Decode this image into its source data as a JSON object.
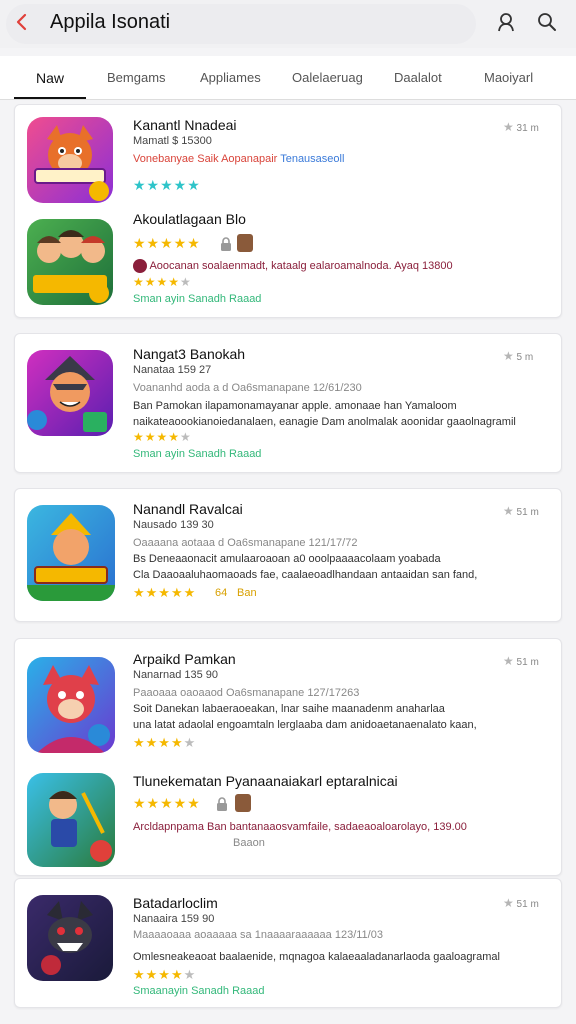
{
  "header": {
    "title": "Appila Isonati",
    "back_icon": "chevron-left-icon",
    "account_icon": "person-icon",
    "search_icon": "search-icon",
    "accent": "#e0403a"
  },
  "tabs": [
    {
      "label": "Naw"
    },
    {
      "label": "Bemgams"
    },
    {
      "label": "Appliames"
    },
    {
      "label": "Oalelaeruag"
    },
    {
      "label": "Daalalot"
    },
    {
      "label": "Maoiyarl"
    }
  ],
  "cards": [
    {
      "rating_text": "31 m",
      "apps": [
        {
          "name": "Kanantl Nnadeai",
          "sub": "Mamatl $ 15300",
          "line1a": "Vonebanyae Saik Aopanapair",
          "line1b": "Tenausaseoll",
          "stars": 5
        },
        {
          "name": "Akoulatlagaan Blo",
          "line1": "Aoocanan soalaenmadt, kataalg ealaroamalnoda. Ayaq 13800",
          "stars": 4,
          "line2": "Sman ayin Sanadh Raaad"
        }
      ]
    },
    {
      "rating_text": "5 m",
      "apps": [
        {
          "name": "Nangat3 Banokah",
          "sub": "Nanataa 159 27",
          "line0": "Voananhd aoda a d Oa6smanapane 12/61/230",
          "line1": "Ban Pamokan ilapamonamayanar apple. amonaae han Yamaloom",
          "line2": "naikateaoookianoiedanalaen, eanagie Dam anolmalak aoonidar gaaolnagramil",
          "stars": 4,
          "line3": "Sman ayin Sanadh Raaad"
        }
      ]
    },
    {
      "rating_text": "51 m",
      "apps": [
        {
          "name": "Nanandl Ravalcai",
          "sub": "Nausado 139 30",
          "line0": "Oaaaana aotaaa d Oa6smanapane 121/17/72",
          "line1": "Bs Deneaaonacit amulaaroaoan a0 ooolpaaaacolaam yoabada",
          "line2": "Cla Daaoaaluhaomaoads fae, caalaeoadlhandaan antaaidan san fand,",
          "stars": 5,
          "count": "64",
          "extra": "Ban"
        }
      ]
    },
    {
      "rating_text": "51 m",
      "apps": [
        {
          "name": "Arpaikd Pamkan",
          "sub": "Nanarnad 135 90",
          "line0": "Paaoaaa oaoaaod Oa6smanapane 127/17263",
          "line1": "Soit Danekan labaeraoeakan, lnar saihe maanadenm anaharlaa",
          "line2": "una latat adaolal engoamtaln lerglaaba dam anidoaetanaenalato kaan,",
          "stars": 4
        },
        {
          "name": "Tlunekematan Pyanaanaiakarl eptaralnicai",
          "line1": "Arcldapnpama Ban bantanaaosvamfaile, sadaeaoaloarolayo, 139.00",
          "stars": 5,
          "line2": "Baaon"
        }
      ]
    },
    {
      "rating_text": "51 m",
      "apps": [
        {
          "name": "Batadarloclim",
          "sub": "Nanaaira 159 90",
          "line0": "Maaaaoaaa aoaaaaa sa 1naaaaraaaaaa 123/11/03",
          "line1": "Omlesneakeaoat baalaenide, mqnagoa kalaeaaladanarlaoda gaaloagramal",
          "stars": 4,
          "line2": "Smaanayin Sanadh Raaad"
        }
      ]
    }
  ]
}
